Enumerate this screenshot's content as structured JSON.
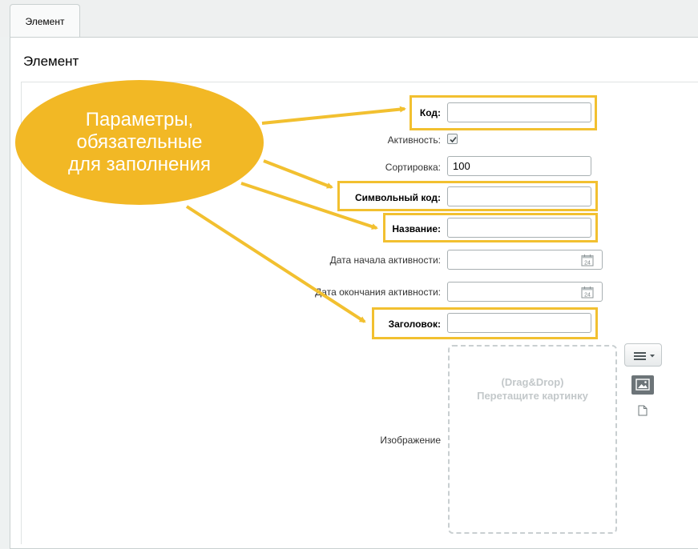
{
  "tab": {
    "label": "Элемент"
  },
  "panel": {
    "title": "Элемент"
  },
  "callout": {
    "lines": [
      "Параметры,",
      "обязательные",
      "для заполнения"
    ]
  },
  "form": {
    "code": {
      "label": "Код:",
      "value": ""
    },
    "active": {
      "label": "Активность:",
      "checked": true
    },
    "sort": {
      "label": "Сортировка:",
      "value": "100"
    },
    "symbolic_code": {
      "label": "Символьный код:",
      "value": ""
    },
    "name": {
      "label": "Название:",
      "value": ""
    },
    "active_from": {
      "label": "Дата начала активности:",
      "value": ""
    },
    "active_to": {
      "label": "Дата окончания активности:",
      "value": ""
    },
    "heading": {
      "label": "Заголовок:",
      "value": ""
    },
    "image": {
      "label": "Изображение",
      "drop_line1": "(Drag&Drop)",
      "drop_line2": "Перетащите картинку"
    },
    "calendar_day": "24"
  },
  "colors": {
    "highlight": "#f2c030",
    "callout": "#f2b825"
  },
  "icons": [
    "calendar-icon",
    "menu-lines-icon",
    "chevron-down-icon",
    "image-icon",
    "file-icon",
    "checkmark-icon"
  ]
}
